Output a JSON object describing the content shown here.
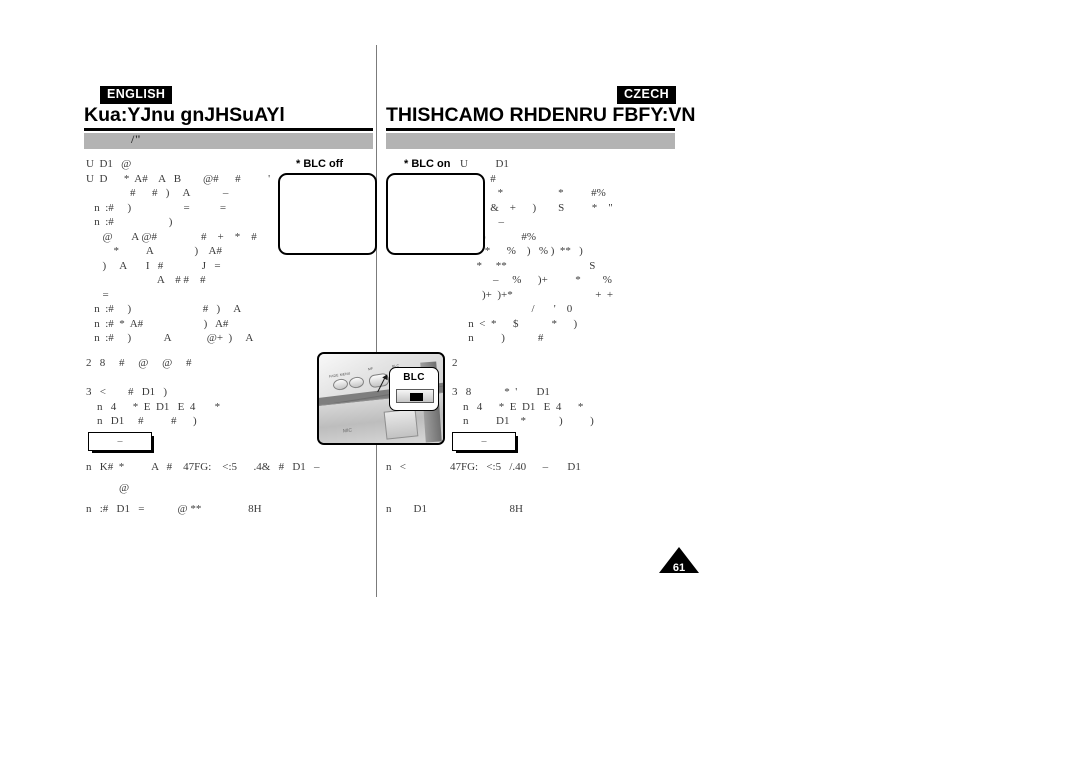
{
  "document": {
    "kind": "camcorder-manual-page",
    "page_number": "61"
  },
  "left_column": {
    "language_tag": "ENGLISH",
    "section_title": "Kua:YJnu gnJHSuAYl",
    "subtitle_bar_text": "/\"",
    "body_lines": [
      "U  D1   @",
      "U  D      *  A#    A   B        @#      #          '",
      "                #      #   )     A            –",
      "   n  :#     )                   =           =",
      "   n  :#                    )",
      "      @       A @#                #    +    *    #",
      "          *          A               )    A#",
      "      )     A       I   #              J   =",
      "                          A    # #    #",
      "      =",
      "   n  :#     )                          #   )     A",
      "   n  :#  *  A#                      )   A#",
      "   n  :#     )            A             @+  )     A"
    ],
    "step_lines": [
      "2   8     #     @     @     #",
      "",
      "3   <        #   D1   )",
      "    n   4      *  E  D1   E  4       *",
      "    n   D1     #          #      )"
    ],
    "note_box_label": "–",
    "footer_lines": [
      "n   K#  *          A   #    47FG:    <:5      .4&   #   D1   –",
      "            @",
      "n   :#   D1   =            @ **                 8H"
    ]
  },
  "right_column": {
    "language_tag": "CZECH",
    "section_title": "THISHCAMO RHDENRU FBFY:VN",
    "subtitle_bar_text": "",
    "body_lines": [
      "U          D1",
      "           #",
      "U  ?       *                    *          #%",
      "           &    +      )        S          *    \"",
      "              –",
      "   n  .)             #%",
      "   n    *      %    )   % )  **   )",
      "      *     **                              S",
      "            –     %      )+          *        %",
      "        )+  )+*                              +  +",
      "                          /       '    0",
      "   n  <  *      $            *      )",
      "   n          )            #"
    ],
    "step_lines": [
      "2",
      "",
      "3   8            *  '       D1",
      "    n   4      *  E  D1   E  4      *",
      "    n          D1    *            )          )"
    ],
    "note_box_label": "–",
    "footer_lines": [
      "n   <                47FG:   <:5   /.40      –       D1",
      "",
      "n        D1                              8H"
    ]
  },
  "samples": {
    "off_caption": "* BLC off",
    "on_caption": "* BLC on"
  },
  "callout": {
    "label": "BLC"
  },
  "colors": {
    "gray_bar": "#b3b3b3",
    "rule": "#000000",
    "text": "#3a3a3a"
  }
}
